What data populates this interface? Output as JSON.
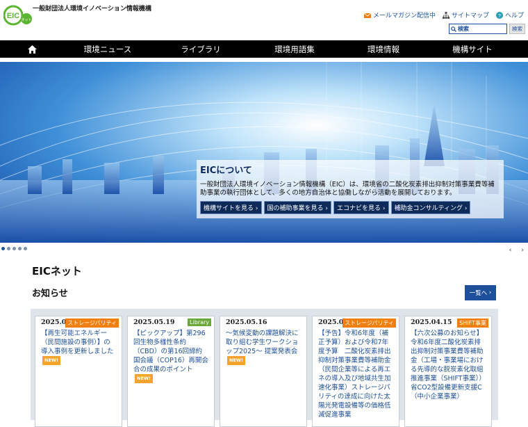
{
  "header": {
    "logo_text": "EIC",
    "logo_sub": "ネット",
    "org_name": "一般財団法人環境イノベーション情報機構",
    "util_links": [
      {
        "label": "メールマガジン配信中",
        "icon": "mail-icon"
      },
      {
        "label": "サイトマップ",
        "icon": "sitemap-icon"
      },
      {
        "label": "ヘルプ",
        "icon": "help-icon"
      }
    ],
    "search_label": "検索",
    "search_button": "検索"
  },
  "nav": {
    "items": [
      "環境ニュース",
      "ライブラリ",
      "環境用語集",
      "環境情報",
      "機構サイト"
    ]
  },
  "hero": {
    "about_title": "EICについて",
    "about_text": "一般財団法人環境イノベーション情報機構（EIC）は、環境省の二酸化炭素排出抑制対策事業費等補助事業の執行団体として、多くの地方自治体と協働しながら活動を展開しております。",
    "links": [
      "機構サイトを見る",
      "国の補助事業を見る",
      "エコナビを見る",
      "補助金コンサルティング"
    ],
    "slide_count": 5,
    "active_slide": 1
  },
  "main": {
    "section_title": "EICネット",
    "news_title": "お知らせ",
    "more_label": "一覧へ",
    "new_badge": "NEW!",
    "news": [
      {
        "date": "2025.05.26",
        "tag": "ストレージパリティ",
        "tag_color": "#f07f0f",
        "text": "【再生可能エネルギー（民間施設の事例）】の導入事例を更新しました",
        "is_new": true
      },
      {
        "date": "2025.05.19",
        "tag": "Library",
        "tag_color": "#6aa83a",
        "text": "【ピックアップ】第296回生物多様性条約（CBD）の第16回締約国会議（COP16）再開会合の成果のポイント",
        "is_new": true
      },
      {
        "date": "2025.05.16",
        "tag": "",
        "tag_color": "",
        "text": "～気候変動の課題解決に取り組む学生ワークショップ2025～ 提案発表会",
        "is_new": true
      },
      {
        "date": "2025.05.07",
        "tag": "ストレージパリティ",
        "tag_color": "#f07f0f",
        "text": "【予告】令和6年度（補正予算）および令和7年度予算　二酸化炭素排出抑制対策事業費等補助金（民間企業等による再エネの導入及び地域共生加速化事業）ストレージパリティの達成に向けた太陽光発電設備等の価格低減促進事業",
        "is_new": false
      },
      {
        "date": "2025.04.15",
        "tag": "SHIFT事業",
        "tag_color": "#f07f0f",
        "text": "【六次公募のお知らせ】令和6年度二酸化炭素排出抑制対策事業費等補助金（工場・事業場における先導的な脱炭素化取組推進事業（SHIFT事業））省CO2型設備更新支援C（中小企業事業）",
        "is_new": false
      }
    ]
  },
  "colors": {
    "brand_blue": "#1d4f9a",
    "nav_bg": "#000000",
    "logo_green": "#5cb531",
    "tag_orange": "#f07f0f",
    "tag_green": "#6aa83a"
  }
}
